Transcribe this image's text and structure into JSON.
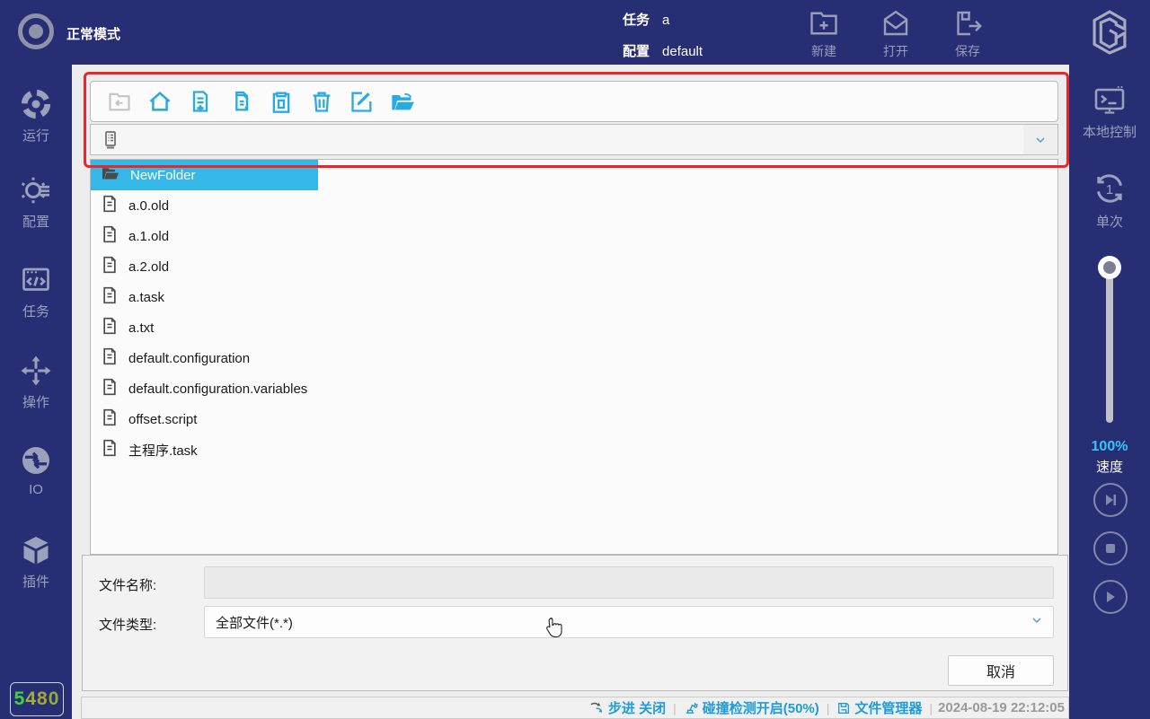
{
  "header": {
    "mode_label": "正常模式",
    "task_label": "任务",
    "task_value": "a",
    "config_label": "配置",
    "config_value": "default",
    "actions": [
      {
        "label": "新建",
        "icon": "new-task-icon"
      },
      {
        "label": "打开",
        "icon": "open-task-icon"
      },
      {
        "label": "保存",
        "icon": "save-task-icon"
      }
    ]
  },
  "left_sidebar": {
    "items": [
      {
        "label": "运行",
        "icon": "run-icon"
      },
      {
        "label": "配置",
        "icon": "configure-icon"
      },
      {
        "label": "任务",
        "icon": "task-icon"
      },
      {
        "label": "操作",
        "icon": "operate-icon"
      },
      {
        "label": "IO",
        "icon": "io-icon"
      },
      {
        "label": "插件",
        "icon": "plugin-icon"
      }
    ],
    "counter": "5480",
    "counter_colors": [
      "#3ed23e",
      "#a4af38",
      "#a8a438",
      "#8fae3a"
    ]
  },
  "right_sidebar": {
    "local_control_label": "本地控制",
    "single_run_label": "单次",
    "speed_percent": "100%",
    "speed_label": "速度",
    "media_buttons": [
      "skip-to-end-icon",
      "stop-icon",
      "play-icon"
    ]
  },
  "file_manager": {
    "toolbar_icons": [
      "back-icon",
      "home-icon",
      "new-file-icon",
      "copy-icon",
      "paste-icon",
      "delete-icon",
      "rename-icon",
      "open-folder-icon"
    ],
    "path_value": "",
    "files": [
      {
        "name": "NewFolder",
        "type": "folder",
        "selected": true
      },
      {
        "name": "a.0.old",
        "type": "file",
        "selected": false
      },
      {
        "name": "a.1.old",
        "type": "file",
        "selected": false
      },
      {
        "name": "a.2.old",
        "type": "file",
        "selected": false
      },
      {
        "name": "a.task",
        "type": "file",
        "selected": false
      },
      {
        "name": "a.txt",
        "type": "file",
        "selected": false
      },
      {
        "name": "default.configuration",
        "type": "file",
        "selected": false
      },
      {
        "name": "default.configuration.variables",
        "type": "file",
        "selected": false
      },
      {
        "name": "offset.script",
        "type": "file",
        "selected": false
      },
      {
        "name": "主程序.task",
        "type": "file",
        "selected": false
      }
    ],
    "filename_label": "文件名称:",
    "filename_value": "",
    "filetype_label": "文件类型:",
    "filetype_value": "全部文件(*.*)",
    "cancel_label": "取消"
  },
  "status_bar": {
    "step_text": "步进 关闭",
    "collision_text": "碰撞检测开启(50%)",
    "window_text": "文件管理器",
    "timestamp": "2024-08-19 22:12:05"
  },
  "colors": {
    "navy": "#272e74",
    "accent_cyan": "#29abe2",
    "selection_cyan": "#35b7e8",
    "annotation_red": "#e8272c",
    "status_blue": "#1e9cd7",
    "sidebar_icon_gray": "#9aa1bb"
  }
}
